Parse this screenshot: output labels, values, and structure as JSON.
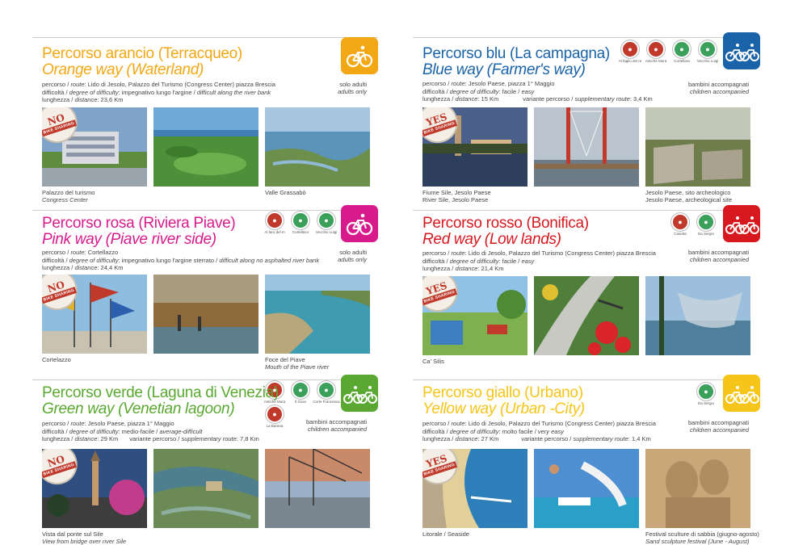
{
  "left": {
    "sections": [
      {
        "color": "#f2a814",
        "title_it": "Percorso arancio (Terracqueo)",
        "title_en": "Orange way (Waterland)",
        "route_line_label": "percorso / ",
        "route_line_label_en": "route",
        "route_line_value": ": Lido di Jesolo, Palazzo del Turismo (Congress Center) piazza Brescia",
        "difficulty_label": "difficoltà / ",
        "difficulty_label_en": "degree of difficulty",
        "difficulty_value": ": impegnativo lungo l'argine / ",
        "difficulty_value_en": "difficult along the river bank",
        "length_label": "lunghezza / ",
        "length_label_en": "distance",
        "length_value": ": 23,6 Km",
        "audience": "solo adulti",
        "audience_en": "adults only",
        "bike_sharing": "NO",
        "captions": [
          {
            "it": "Palazzo del turismo",
            "en": "Congress Center"
          },
          {
            "it": "",
            "en": ""
          },
          {
            "it": "Valle Grassabò",
            "en": ""
          }
        ]
      },
      {
        "color": "#d81b8c",
        "title_it": "Percorso rosa (Riviera Piave)",
        "title_en": "Pink way (Piave river side)",
        "route_line_label": "percorso / ",
        "route_line_label_en": "route",
        "route_line_value": ": Cortellazzo",
        "difficulty_label": "difficoltà / ",
        "difficulty_label_en": "degree of difficulty",
        "difficulty_value": ": impegnativo lungo l'argine sterrato / ",
        "difficulty_value_en": "difficult along no asphalted river bank",
        "length_label": "lunghezza / ",
        "length_label_en": "distance",
        "length_value": ": 24,4 Km",
        "audience": "solo adulti",
        "audience_en": "adults only",
        "bike_sharing": "NO",
        "stamps": [
          {
            "label": "Al faro del m",
            "kind": "red"
          },
          {
            "label": "Cortellazo",
            "kind": "green"
          },
          {
            "label": "Vecchio Luigi",
            "kind": "green"
          }
        ],
        "captions": [
          {
            "it": "Cortelazzo",
            "en": ""
          },
          {
            "it": "",
            "en": ""
          },
          {
            "it": "Foce del Piave",
            "en": "Mouth of the Piave river"
          }
        ]
      },
      {
        "color": "#5aa832",
        "title_it": "Percorso verde (Laguna di Venezia)",
        "title_en": "Green way (Venetian lagoon)",
        "route_line_label": "percorso / ",
        "route_line_label_en": "route",
        "route_line_value": ": Jesolo Paese, piazza 1° Maggio",
        "difficulty_label": "difficoltà / ",
        "difficulty_label_en": "degree of difficulty",
        "difficulty_value": ": medio-facile / ",
        "difficulty_value_en": "average-difficult",
        "length_label": "lunghezza / ",
        "length_label_en": "distance",
        "length_value": ": 29 Km",
        "variant_label": "variante percorso / ",
        "variant_label_en": "supplementary route",
        "variant_value": ": 7,8 Km",
        "audience": "bambini accompagnati",
        "audience_en": "children accompanied",
        "bike_sharing": "NO",
        "stamps": [
          {
            "label": "Antiche Mura",
            "kind": "red"
          },
          {
            "label": "Il Gioio",
            "kind": "green"
          },
          {
            "label": "Corte Francesca",
            "kind": "green"
          },
          {
            "label": "La Barena",
            "kind": "red"
          }
        ],
        "captions": [
          {
            "it": "Vista dal ponte sul Sile",
            "en": "View from bridge over river Sile"
          },
          {
            "it": "",
            "en": ""
          },
          {
            "it": "",
            "en": ""
          }
        ]
      }
    ]
  },
  "right": {
    "sections": [
      {
        "color": "#1a63a8",
        "title_it": "Percorso blu (La campagna)",
        "title_en": "Blue way (Farmer's way)",
        "route_line_label": "percorso / ",
        "route_line_label_en": "route",
        "route_line_value": ": Jesolo Paese, piazza 1° Maggio",
        "difficulty_label": "difficoltà / ",
        "difficulty_label_en": "degree of difficulty",
        "difficulty_value": ": facile / ",
        "difficulty_value_en": "easy",
        "length_label": "lunghezza / ",
        "length_label_en": "distance",
        "length_value": ": 15 Km",
        "variant_label": "variante percorso / ",
        "variant_label_en": "supplementary route",
        "variant_value": ": 3,4 Km",
        "audience": "bambini accompagnati",
        "audience_en": "children accompanied",
        "bike_sharing": "YES",
        "stamps": [
          {
            "label": "Al faglio del re",
            "kind": "red"
          },
          {
            "label": "Antiche Mura",
            "kind": "red"
          },
          {
            "label": "Cortellara",
            "kind": "green"
          },
          {
            "label": "Vecchio Luigi",
            "kind": "green"
          }
        ],
        "captions": [
          {
            "it": "Fiume Sile, Jesolo Paese",
            "en": "River Sile, Jesolo Paese"
          },
          {
            "it": "",
            "en": ""
          },
          {
            "it": "Jesolo Paese, sito archeologico",
            "en": "Jesolo Paese, archeological site"
          }
        ]
      },
      {
        "color": "#d7191f",
        "title_it": "Percorso rosso (Bonifica)",
        "title_en": "Red way (Low lands)",
        "route_line_label": "percorso / ",
        "route_line_label_en": "route",
        "route_line_value": ": Lido di Jesolo, Palazzo del Turismo (Congress Center) piazza Brescia",
        "difficulty_label": "difficoltà / ",
        "difficulty_label_en": "degree of difficulty",
        "difficulty_value": ": facile / ",
        "difficulty_value_en": "easy",
        "length_label": "lunghezza / ",
        "length_label_en": "distance",
        "length_value": ": 21,4 Km",
        "audience": "bambini accompagnati",
        "audience_en": "children accompanied",
        "bike_sharing": "YES",
        "stamps": [
          {
            "label": "Casetta",
            "kind": "red"
          },
          {
            "label": "Da Sergio",
            "kind": "green"
          }
        ],
        "captions": [
          {
            "it": "Ca' Silis",
            "en": ""
          },
          {
            "it": "",
            "en": ""
          },
          {
            "it": "",
            "en": ""
          }
        ]
      },
      {
        "color": "#f5c51a",
        "title_it": "Percorso giallo (Urbano)",
        "title_en": "Yellow way (Urban -City)",
        "route_line_label": "percorso / ",
        "route_line_label_en": "route",
        "route_line_value": ": Lido di Jesolo, Palazzo del Turismo (Congress Center) piazza Brescia",
        "difficulty_label": "difficoltà / ",
        "difficulty_label_en": "degree of difficulty",
        "difficulty_value": ": molto facile / ",
        "difficulty_value_en": "very easy",
        "length_label": "lunghezza / ",
        "length_label_en": "distance",
        "length_value": ": 27 Km",
        "variant_label": "variante percorso / ",
        "variant_label_en": "supplementary route",
        "variant_value": ": 1,4 Km",
        "audience": "bambini accompagnati",
        "audience_en": "children accompanied",
        "bike_sharing": "YES",
        "stamps": [
          {
            "label": "Da Sergio",
            "kind": "green"
          }
        ],
        "captions": [
          {
            "it": "Litorale / Seaside",
            "en": ""
          },
          {
            "it": "",
            "en": ""
          },
          {
            "it": "Festival sculture di sabbia (giugno-agosto)",
            "en": "Sand sculpture festival (June - August)"
          }
        ]
      }
    ]
  },
  "bike_sharing_text": "BIKE SHARING"
}
